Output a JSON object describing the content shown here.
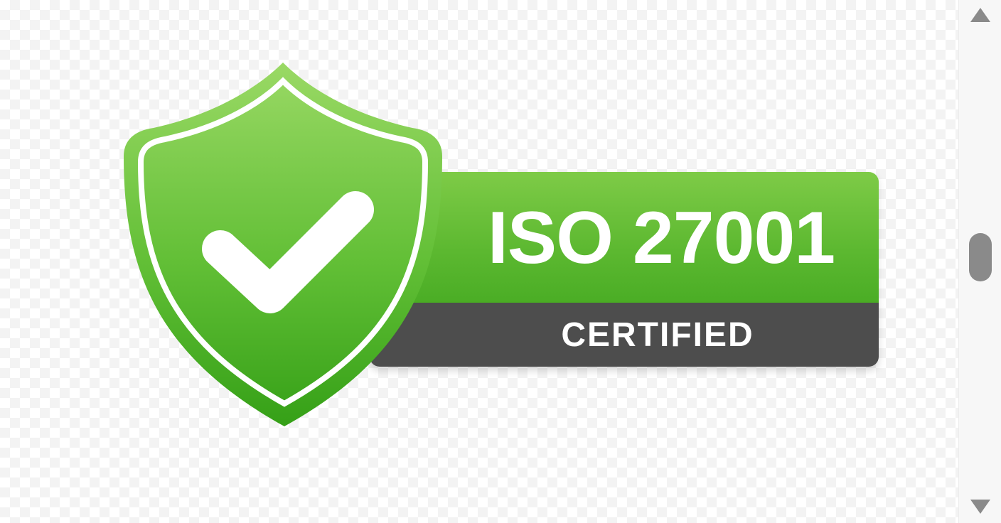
{
  "badge": {
    "title": "ISO 27001",
    "subtitle": "CERTIFIED",
    "shield_icon": "shield-icon",
    "check_icon": "checkmark-icon",
    "colors": {
      "green_light": "#8fd45a",
      "green_dark": "#3fa21c",
      "band_gray": "#4d4d4d",
      "text": "#ffffff"
    }
  },
  "scrollbar": {
    "up_icon": "triangle-up-icon",
    "down_icon": "triangle-down-icon",
    "thumb_color": "#8a8a8a"
  }
}
